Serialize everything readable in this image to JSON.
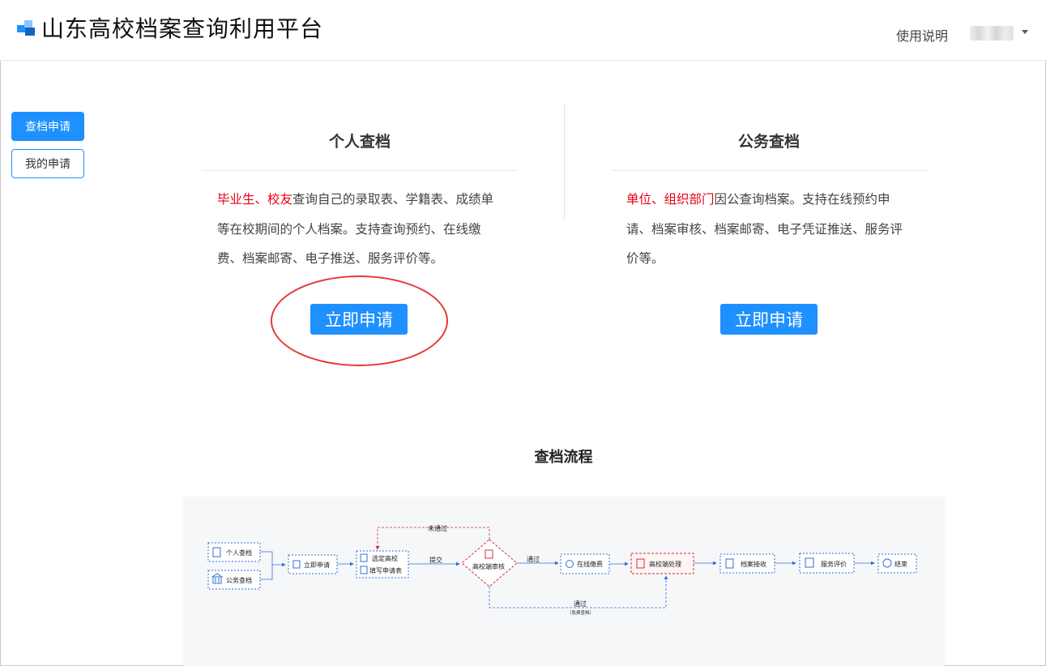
{
  "header": {
    "app_title": "山东高校档案查询利用平台",
    "help_label": "使用说明"
  },
  "sidebar": {
    "items": [
      {
        "label": "查档申请",
        "active": true
      },
      {
        "label": "我的申请",
        "active": false
      }
    ]
  },
  "cards": {
    "personal": {
      "title": "个人查档",
      "desc_highlight": "毕业生、校友",
      "desc_text": "查询自己的录取表、学籍表、成绩单等在校期间的个人档案。支持查询预约、在线缴费、档案邮寄、电子推送、服务评价等。",
      "button_label": "立即申请"
    },
    "official": {
      "title": "公务查档",
      "desc_highlight": "单位、组织部门",
      "desc_text": "因公查询档案。支持在线预约申请、档案审核、档案邮寄、电子凭证推送、服务评价等。",
      "button_label": "立即申请"
    }
  },
  "flow": {
    "title": "查档流程",
    "nodes": {
      "personal": "个人查档",
      "official": "公务查档",
      "apply": "立即申请",
      "select_school": "选定高校",
      "fill_form": "填写申请表",
      "review": "高校端审核",
      "pay": "在线缴费",
      "process": "高校端处理",
      "receive": "档案接收",
      "evaluate": "服务评价",
      "end": "结束"
    },
    "edges": {
      "submit": "提交",
      "pass": "通过",
      "not_pass": "未通过",
      "pass_free": "通过",
      "free_note": "（免费查档）"
    }
  },
  "colors": {
    "accent": "#1e90ff",
    "highlight": "#e60012",
    "annotation": "#e53935"
  }
}
